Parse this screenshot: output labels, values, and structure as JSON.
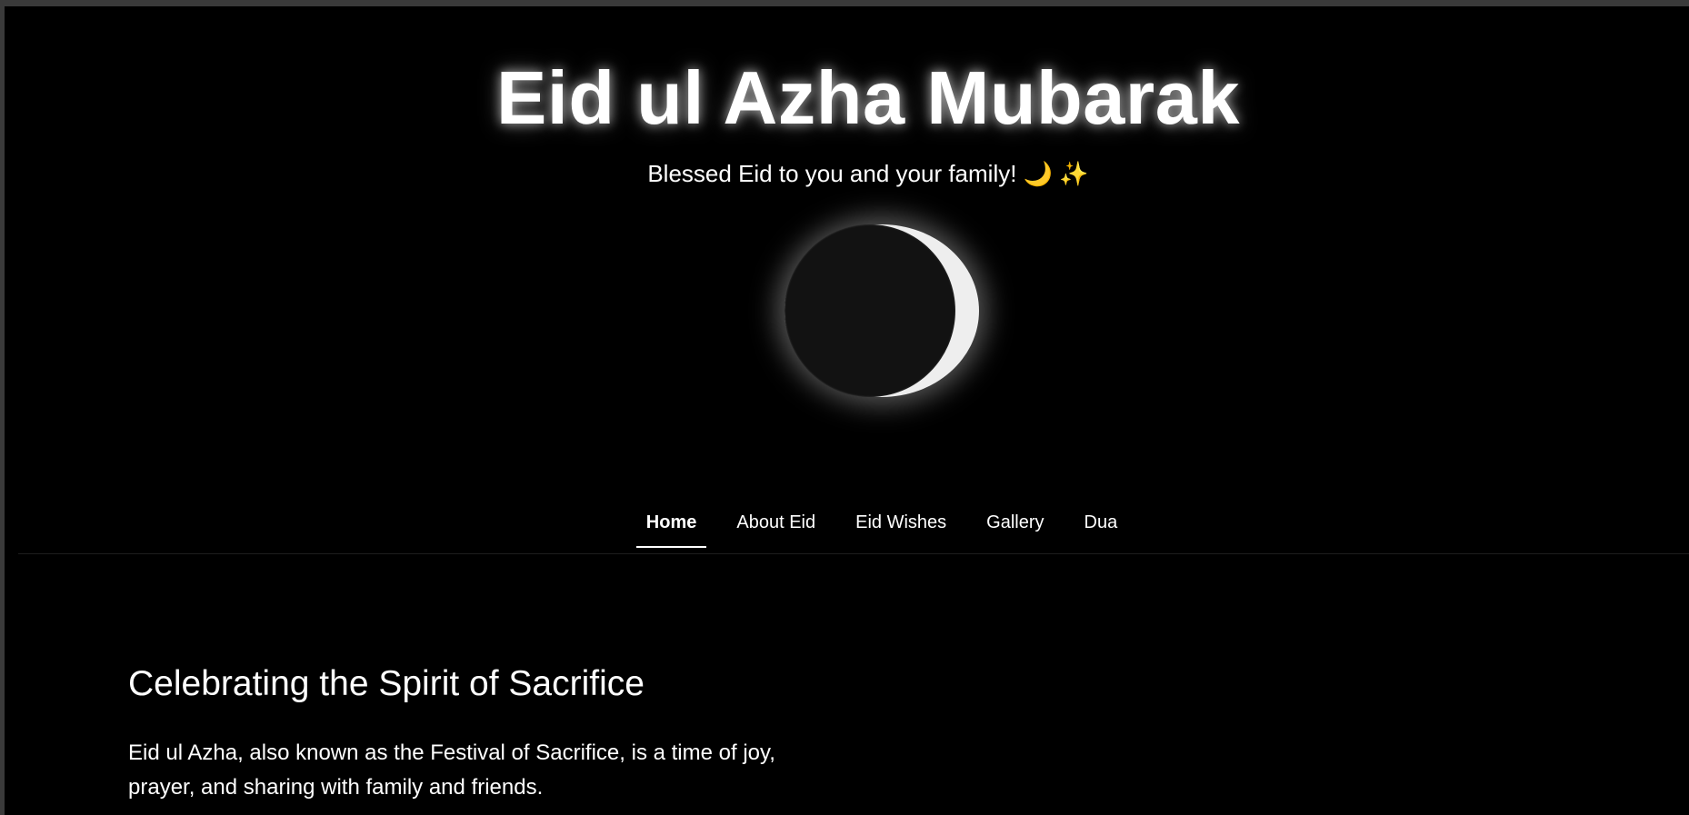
{
  "hero": {
    "title": "Eid ul Azha Mubarak",
    "subtitle": "Blessed Eid to you and your family! 🌙 ✨"
  },
  "nav": {
    "items": [
      {
        "label": "Home",
        "active": true
      },
      {
        "label": "About Eid",
        "active": false
      },
      {
        "label": "Eid Wishes",
        "active": false
      },
      {
        "label": "Gallery",
        "active": false
      },
      {
        "label": "Dua",
        "active": false
      }
    ]
  },
  "main": {
    "heading": "Celebrating the Spirit of Sacrifice",
    "paragraph": "Eid ul Azha, also known as the Festival of Sacrifice, is a time of joy, prayer, and sharing with family and friends."
  },
  "colors": {
    "background": "#000000",
    "text": "#ffffff",
    "moon_light": "#eeeeee",
    "moon_dark": "#121212"
  },
  "icons": {
    "moon": "crescent-moon-icon"
  }
}
